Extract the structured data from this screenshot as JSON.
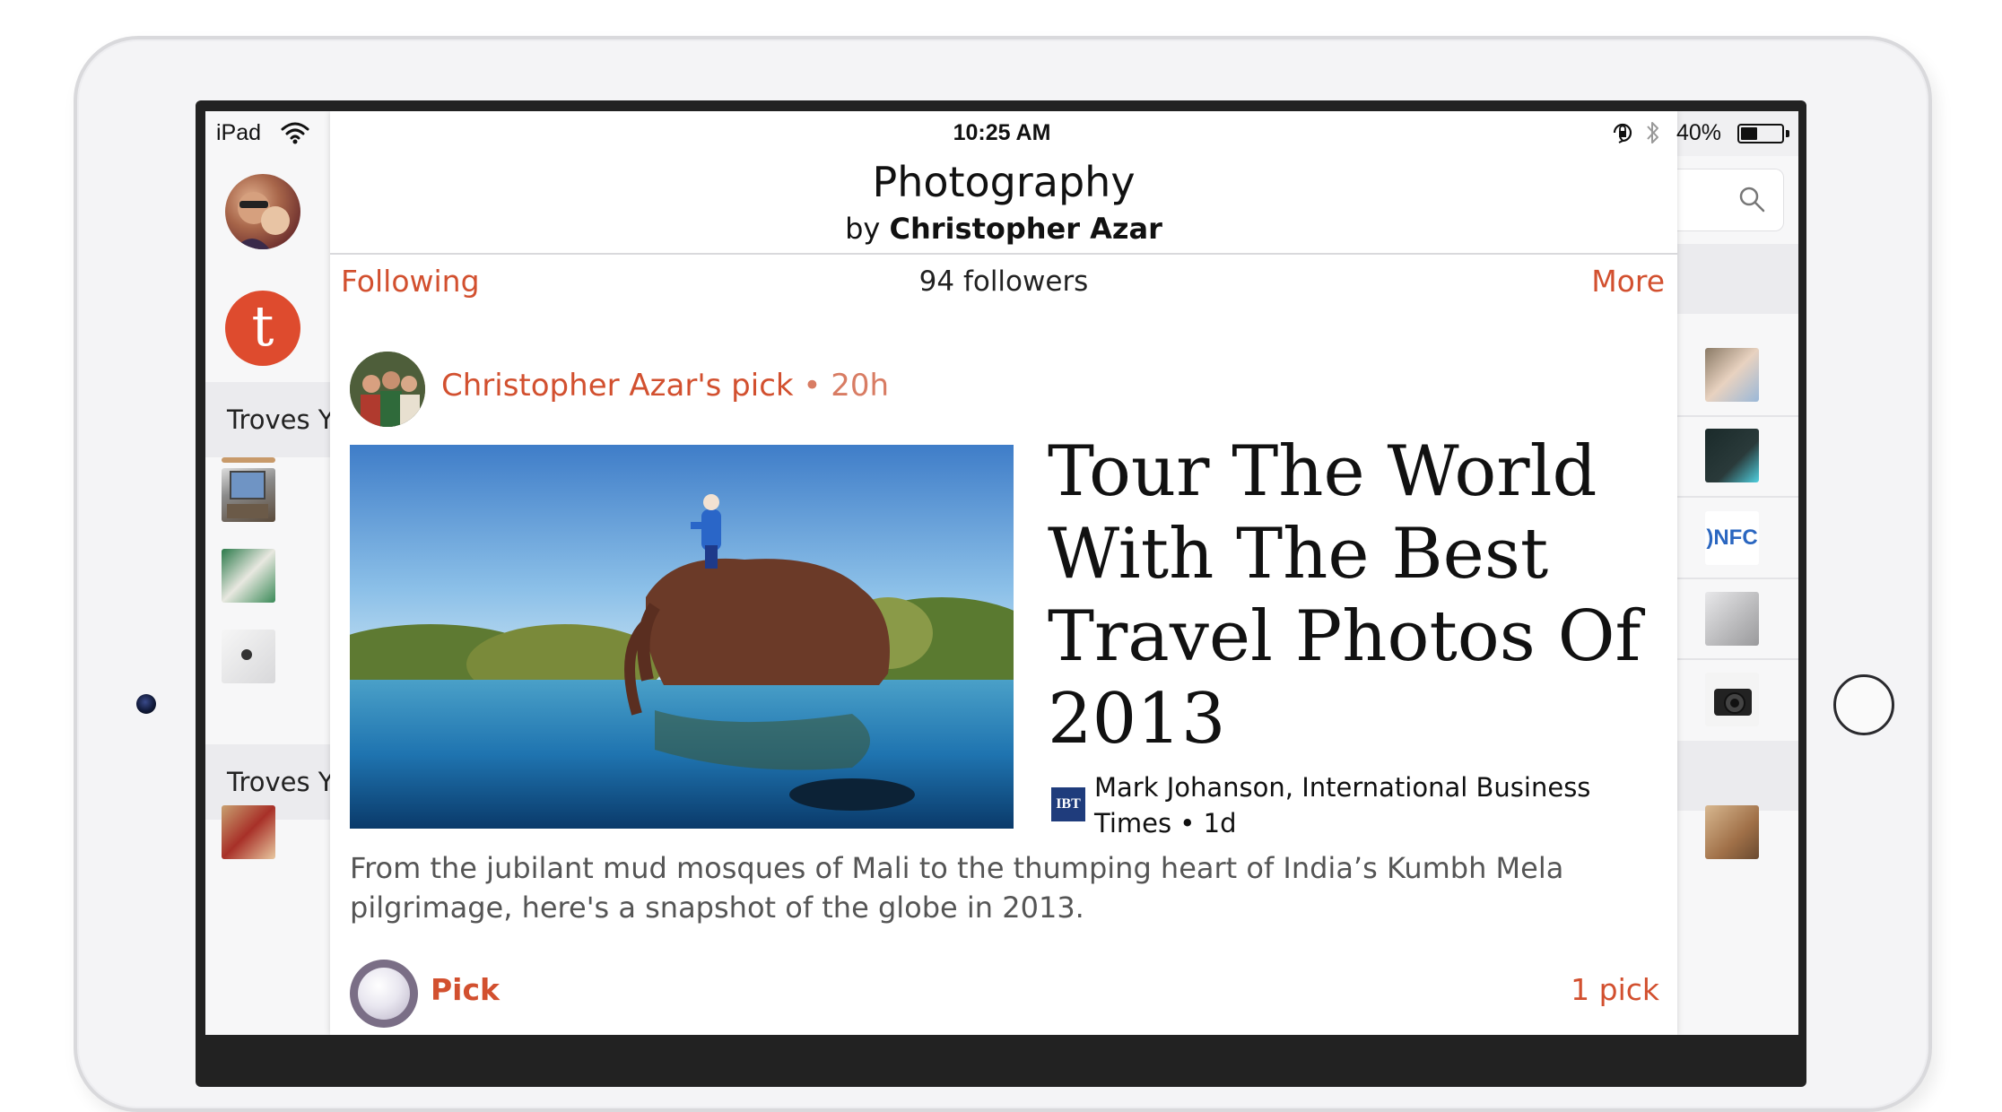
{
  "status_bar": {
    "carrier": "iPad",
    "time": "10:25 AM",
    "battery_percent": "40%",
    "battery_level": 0.4
  },
  "left_sidebar": {
    "section_1_label": "Troves You Follow",
    "section_2_label": "Troves You Follow",
    "logo_letter": "t"
  },
  "trove": {
    "title": "Photography",
    "by_prefix": "by",
    "author": "Christopher Azar",
    "following_label": "Following",
    "followers": "94 followers",
    "more_label": "More"
  },
  "item": {
    "picker": "Christopher Azar's pick",
    "separator": "•",
    "age": "20h",
    "headline": "Tour The World With The Best Travel Photos Of 2013",
    "source_logo": "IBT",
    "source": "Mark Johanson, International Business Times • 1d",
    "summary": "From the jubilant mud mosques of Mali to the thumping heart of India’s Kumbh Mela pilgrimage, here's a snapshot of the globe in 2013.",
    "pick_label": "Pick",
    "pick_count": "1 pick"
  },
  "right_sidebar": {
    "thumb_text_nfc": ")NFC"
  },
  "colors": {
    "accent": "#d2502f",
    "brand_logo": "#de4b2e"
  },
  "icons": [
    "wifi-icon",
    "rotation-lock-icon",
    "bluetooth-icon",
    "battery-icon",
    "search-icon"
  ]
}
